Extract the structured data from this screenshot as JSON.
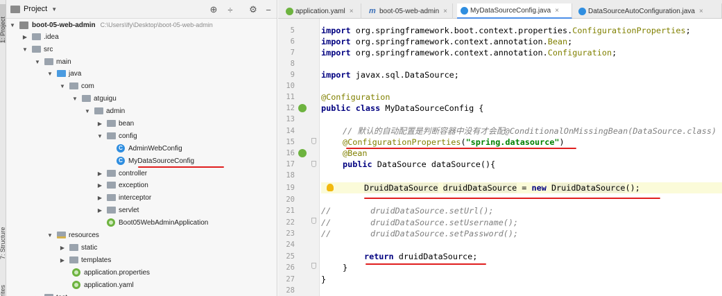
{
  "side_stripe": {
    "project": "1: Project",
    "structure": "7: Structure",
    "favorites": "orites"
  },
  "project": {
    "title": "Project",
    "tree": [
      {
        "label": "boot-05-web-admin",
        "path": "C:\\Users\\lfy\\Desktop\\boot-05-web-admin",
        "bold": true
      },
      {
        "label": ".idea"
      },
      {
        "label": "src"
      },
      {
        "label": "main"
      },
      {
        "label": "java"
      },
      {
        "label": "com"
      },
      {
        "label": "atguigu"
      },
      {
        "label": "admin"
      },
      {
        "label": "bean"
      },
      {
        "label": "config"
      },
      {
        "label": "AdminWebConfig"
      },
      {
        "label": "MyDataSourceConfig"
      },
      {
        "label": "controller"
      },
      {
        "label": "exception"
      },
      {
        "label": "interceptor"
      },
      {
        "label": "servlet"
      },
      {
        "label": "Boot05WebAdminApplication"
      },
      {
        "label": "resources"
      },
      {
        "label": "static"
      },
      {
        "label": "templates"
      },
      {
        "label": "application.properties"
      },
      {
        "label": "application.yaml"
      },
      {
        "label": "test"
      }
    ]
  },
  "tabs": [
    {
      "label": "application.yaml"
    },
    {
      "label": "boot-05-web-admin"
    },
    {
      "label": "MyDataSourceConfig.java",
      "active": true
    },
    {
      "label": "DataSourceAutoConfiguration.java"
    }
  ],
  "code": {
    "line_numbers": [
      "5",
      "6",
      "7",
      "8",
      "9",
      "10",
      "11",
      "12",
      "13",
      "14",
      "15",
      "16",
      "17",
      "18",
      "19",
      "20",
      "21",
      "22",
      "23",
      "24",
      "25",
      "26",
      "27",
      "28"
    ],
    "l5": {
      "kw": "import",
      "rest": " org.springframework.boot.context.properties.",
      "cls": "ConfigurationProperties",
      "end": ";"
    },
    "l6": {
      "kw": "import",
      "rest": " org.springframework.context.annotation.",
      "cls": "Bean",
      "end": ";"
    },
    "l7": {
      "kw": "import",
      "rest": " org.springframework.context.annotation.",
      "cls": "Configuration",
      "end": ";"
    },
    "l9": {
      "kw": "import",
      "rest": " javax.sql.DataSource;"
    },
    "l11": {
      "ann": "@Configuration"
    },
    "l12": {
      "kw": "public class",
      "rest": " MyDataSourceConfig {"
    },
    "l14": {
      "cm": "// 默认的自动配置是判断容器中没有才会配@ConditionalOnMissingBean(DataSource.class)"
    },
    "l15": {
      "at": "@",
      "ann": "ConfigurationProperties",
      "open": "(",
      "str": "\"spring.datasource\"",
      "close": ")"
    },
    "l16": {
      "ann": "@Bean"
    },
    "l17": {
      "kw": "public",
      "rest": " DataSource dataSource(){"
    },
    "l19": {
      "t1": "DruidDataSource",
      "t2": " ",
      "t3": "druidDataSource",
      "t4": " = ",
      "kw": "new",
      "t5": " ",
      "t6": "DruidDataSource",
      "t7": "();"
    },
    "l21": {
      "c": "//",
      "cm": "        druidDataSource.setUrl();"
    },
    "l22": {
      "c": "//",
      "cm": "        druidDataSource.setUsername();"
    },
    "l23": {
      "c": "//",
      "cm": "        druidDataSource.setPassword();"
    },
    "l25": {
      "kw": "return",
      "rest": " druidDataSource;"
    },
    "l26": {
      "rest": "}"
    },
    "l27": {
      "rest": "}"
    }
  },
  "colors": {
    "annotation_underline": "#e01e1e",
    "keyword": "#000080",
    "annotation": "#808000",
    "string": "#008000"
  }
}
